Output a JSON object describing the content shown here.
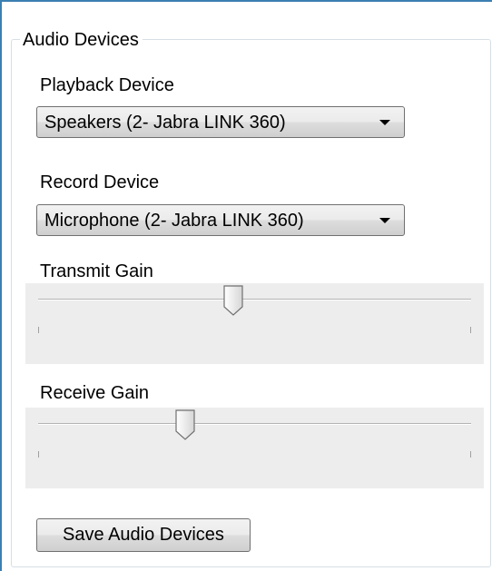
{
  "audio_devices": {
    "group_title": "Audio Devices",
    "playback": {
      "label": "Playback Device",
      "selected": "Speakers (2- Jabra LINK 360)"
    },
    "record": {
      "label": "Record Device",
      "selected": "Microphone (2- Jabra LINK 360)"
    },
    "transmit_gain": {
      "label": "Transmit Gain",
      "value_fraction": 0.45
    },
    "receive_gain": {
      "label": "Receive Gain",
      "value_fraction": 0.34
    },
    "save_button_label": "Save Audio Devices"
  },
  "colors": {
    "window_border": "#3c7fb1",
    "group_border": "#d5dfe5",
    "slider_panel": "#ededed"
  }
}
